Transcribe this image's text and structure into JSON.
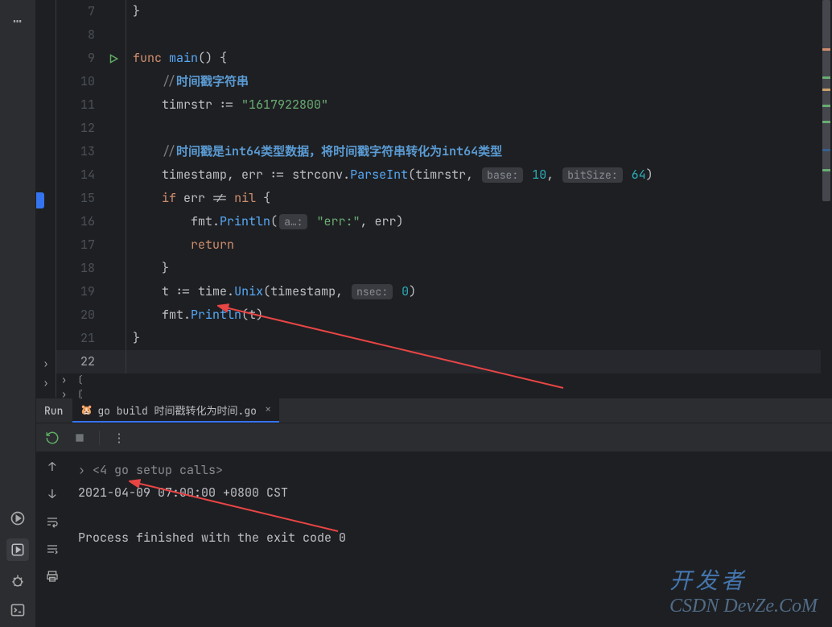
{
  "editor": {
    "lines": [
      {
        "n": 7,
        "tokens": [
          {
            "t": "}",
            "c": "paren"
          }
        ]
      },
      {
        "n": 8,
        "tokens": []
      },
      {
        "n": 9,
        "run": true,
        "tokens": [
          {
            "t": "func ",
            "c": "kw"
          },
          {
            "t": "main",
            "c": "fn"
          },
          {
            "t": "() {",
            "c": "paren"
          }
        ]
      },
      {
        "n": 10,
        "tokens": [
          {
            "t": "    ",
            "c": ""
          },
          {
            "t": "//",
            "c": "comment"
          },
          {
            "t": "时间戳字符串",
            "c": "comment-hl"
          }
        ]
      },
      {
        "n": 11,
        "tokens": [
          {
            "t": "    timrstr ",
            "c": "ident"
          },
          {
            "t": ":=",
            "c": "ident"
          },
          {
            "t": " ",
            "c": ""
          },
          {
            "t": "\"1617922800\"",
            "c": "str"
          }
        ]
      },
      {
        "n": 12,
        "tokens": []
      },
      {
        "n": 13,
        "tokens": [
          {
            "t": "    ",
            "c": ""
          },
          {
            "t": "//",
            "c": "comment"
          },
          {
            "t": "时间戳是",
            "c": "comment-hl"
          },
          {
            "t": "int64",
            "c": "comment-hl",
            "b": true
          },
          {
            "t": "类型数据，将时间戳字符串转化为",
            "c": "comment-hl"
          },
          {
            "t": "int64",
            "c": "comment-hl",
            "b": true
          },
          {
            "t": "类型",
            "c": "comment-hl"
          }
        ]
      },
      {
        "n": 14,
        "tokens": [
          {
            "t": "    timestamp",
            "c": "ident"
          },
          {
            "t": ", ",
            "c": "paren"
          },
          {
            "t": "err ",
            "c": "ident"
          },
          {
            "t": ":=",
            "c": "ident"
          },
          {
            "t": " strconv",
            "c": "ident"
          },
          {
            "t": ".",
            "c": "paren"
          },
          {
            "t": "ParseInt",
            "c": "fn"
          },
          {
            "t": "(",
            "c": "paren"
          },
          {
            "t": "timrstr",
            "c": "ident"
          },
          {
            "t": ", ",
            "c": "paren"
          },
          {
            "hint": "base:"
          },
          {
            "t": " ",
            "c": ""
          },
          {
            "t": "10",
            "c": "num"
          },
          {
            "t": ", ",
            "c": "paren"
          },
          {
            "hint": "bitSize:"
          },
          {
            "t": " ",
            "c": ""
          },
          {
            "t": "64",
            "c": "num"
          },
          {
            "t": ")",
            "c": "paren"
          }
        ]
      },
      {
        "n": 15,
        "tokens": [
          {
            "t": "    ",
            "c": ""
          },
          {
            "t": "if ",
            "c": "kw"
          },
          {
            "t": "err ",
            "c": "ident"
          },
          {
            "t": "!=",
            "c": "ident"
          },
          {
            "t": " ",
            "c": ""
          },
          {
            "t": "nil ",
            "c": "kw"
          },
          {
            "t": "{",
            "c": "paren"
          }
        ]
      },
      {
        "n": 16,
        "tokens": [
          {
            "t": "        fmt",
            "c": "ident"
          },
          {
            "t": ".",
            "c": "paren"
          },
          {
            "t": "Println",
            "c": "fn"
          },
          {
            "t": "(",
            "c": "paren"
          },
          {
            "hint": "a…:"
          },
          {
            "t": " ",
            "c": ""
          },
          {
            "t": "\"err:\"",
            "c": "str"
          },
          {
            "t": ", ",
            "c": "paren"
          },
          {
            "t": "err",
            "c": "ident"
          },
          {
            "t": ")",
            "c": "paren"
          }
        ]
      },
      {
        "n": 17,
        "tokens": [
          {
            "t": "        ",
            "c": ""
          },
          {
            "t": "return",
            "c": "kw"
          }
        ]
      },
      {
        "n": 18,
        "tokens": [
          {
            "t": "    }",
            "c": "paren"
          }
        ]
      },
      {
        "n": 19,
        "tokens": [
          {
            "t": "    t ",
            "c": "ident"
          },
          {
            "t": ":=",
            "c": "ident"
          },
          {
            "t": " time",
            "c": "ident"
          },
          {
            "t": ".",
            "c": "paren"
          },
          {
            "t": "Unix",
            "c": "fn"
          },
          {
            "t": "(",
            "c": "paren"
          },
          {
            "t": "timestamp",
            "c": "ident"
          },
          {
            "t": ", ",
            "c": "paren"
          },
          {
            "hint": "nsec:"
          },
          {
            "t": " ",
            "c": ""
          },
          {
            "t": "0",
            "c": "num"
          },
          {
            "t": ")",
            "c": "paren"
          }
        ]
      },
      {
        "n": 20,
        "tokens": [
          {
            "t": "    fmt",
            "c": "ident"
          },
          {
            "t": ".",
            "c": "paren"
          },
          {
            "t": "Println",
            "c": "fn"
          },
          {
            "t": "(",
            "c": "paren"
          },
          {
            "t": "t",
            "c": "ident"
          },
          {
            "t": ")",
            "c": "paren"
          }
        ]
      },
      {
        "n": 21,
        "tokens": [
          {
            "t": "}",
            "c": "paren"
          }
        ]
      },
      {
        "n": 22,
        "current": true,
        "tokens": []
      }
    ]
  },
  "run": {
    "label": "Run",
    "tab_label": "go build 时间戳转化为时间.go"
  },
  "console": {
    "fold": "<4 go setup calls>",
    "output1": "2021-04-09 07:00:00 +0800 CST",
    "output2": "Process finished with the exit code 0"
  },
  "watermark": {
    "cn": "开发者",
    "en": "DevZe.CoM"
  }
}
